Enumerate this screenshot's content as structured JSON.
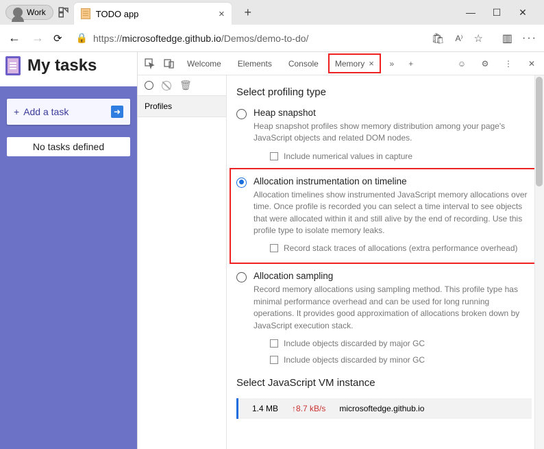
{
  "browser": {
    "work_label": "Work",
    "tab_title": "TODO app",
    "url_host": "microsoftedge.github.io",
    "url_path": "/Demos/demo-to-do/",
    "url_prefix": "https://"
  },
  "page": {
    "heading": "My tasks",
    "add_task_label": "Add a task",
    "add_task_prefix": "+",
    "empty_state": "No tasks defined"
  },
  "devtools": {
    "tabs": {
      "welcome": "Welcome",
      "elements": "Elements",
      "console": "Console",
      "memory": "Memory"
    },
    "profiles_label": "Profiles",
    "section_title": "Select profiling type",
    "heap": {
      "title": "Heap snapshot",
      "desc": "Heap snapshot profiles show memory distribution among your page's JavaScript objects and related DOM nodes.",
      "check1": "Include numerical values in capture"
    },
    "alloc_timeline": {
      "title": "Allocation instrumentation on timeline",
      "desc": "Allocation timelines show instrumented JavaScript memory allocations over time. Once profile is recorded you can select a time interval to see objects that were allocated within it and still alive by the end of recording. Use this profile type to isolate memory leaks.",
      "check1": "Record stack traces of allocations (extra performance overhead)"
    },
    "alloc_sampling": {
      "title": "Allocation sampling",
      "desc": "Record memory allocations using sampling method. This profile type has minimal performance overhead and can be used for long running operations. It provides good approximation of allocations broken down by JavaScript execution stack.",
      "check1": "Include objects discarded by major GC",
      "check2": "Include objects discarded by minor GC"
    },
    "vm_title": "Select JavaScript VM instance",
    "vm_size": "1.4 MB",
    "vm_delta": "↑8.7 kB/s",
    "vm_host": "microsoftedge.github.io"
  }
}
